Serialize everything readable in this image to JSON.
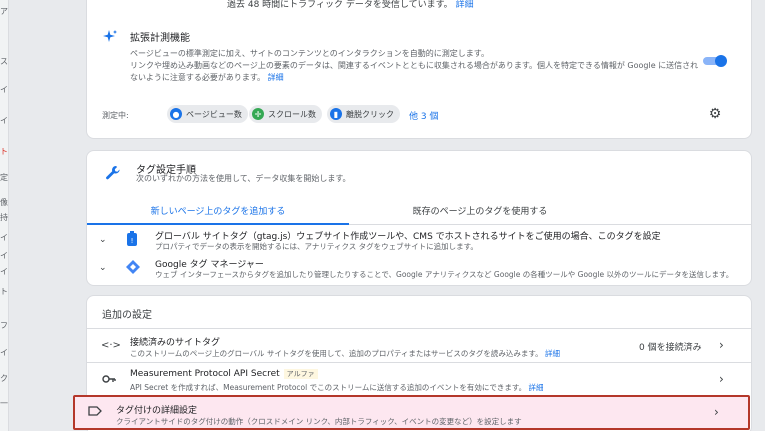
{
  "sidebar": {
    "fragments": [
      "ア",
      "ス",
      "イ",
      "イ",
      "ト",
      "定",
      "像",
      "持",
      "イ",
      "イ",
      "イ",
      "ト",
      "フ",
      "イ",
      "ク",
      "一"
    ]
  },
  "stream": {
    "traffic_note": "過去 48 時間にトラフィック データを受信しています。",
    "traffic_link": "詳細"
  },
  "enhanced_measurement": {
    "title": "拡張計測機能",
    "description_1": "ページビューの標準測定に加え、サイトのコンテンツとのインタラクションを自動的に測定します。",
    "description_2": "リンクや埋め込み動画などのページ上の要素のデータは、関連するイベントとともに収集される場合があります。個人を特定できる情報が Google に送信されないように注意する必要があります。",
    "detail_link": "詳細",
    "toggle_on": true,
    "measuring_label": "測定中:",
    "chips": [
      {
        "label": "ページビュー数",
        "icon": "eye-icon",
        "color": "#1a73e8"
      },
      {
        "label": "スクロール数",
        "icon": "scroll-crosshair-icon",
        "color": "#34a853"
      },
      {
        "label": "離脱クリック",
        "icon": "mouse-click-icon",
        "color": "#1a73e8"
      }
    ],
    "more_link": "他 3 個"
  },
  "tag_setup": {
    "title": "タグ設定手順",
    "subtitle": "次のいずれかの方法を使用して、データ収集を開始します。",
    "tabs": [
      {
        "label": "新しいページ上のタグを追加する",
        "active": true
      },
      {
        "label": "既存のページ上のタグを使用する",
        "active": false
      }
    ],
    "options": [
      {
        "title": "グローバル サイトタグ（gtag.js）ウェブサイト作成ツールや、CMS でホストされるサイトをご使用の場合、このタグを設定",
        "description": "プロパティでデータの表示を開始するには、アナリティクス タグをウェブサイトに追加します。"
      },
      {
        "title": "Google タグ マネージャー",
        "description": "ウェブ インターフェースからタグを追加したり管理したりすることで、Google アナリティクスなど Google の各種ツールや Google 以外のツールにデータを送信します。"
      }
    ]
  },
  "additional_settings": {
    "header": "追加の設定",
    "rows": [
      {
        "icon": "code-brackets-icon",
        "title": "接続済みのサイトタグ",
        "description": "このストリームのページ上のグローバル サイトタグを使用して、追加のプロパティまたはサービスのタグを読み込みます。",
        "link": "詳細",
        "meta": "0 個を接続済み"
      },
      {
        "icon": "key-icon",
        "title": "Measurement Protocol API Secret",
        "badge": "アルファ",
        "description": "API Secret を作成すれば、Measurement Protocol でこのストリームに送信する追加のイベントを有効にできます。",
        "link": "詳細"
      },
      {
        "icon": "tag-icon",
        "title": "タグ付けの詳細設定",
        "description": "クライアントサイドのタグ付けの動作（クロスドメイン リンク、内部トラフィック、イベントの変更など）を設定します"
      }
    ]
  }
}
